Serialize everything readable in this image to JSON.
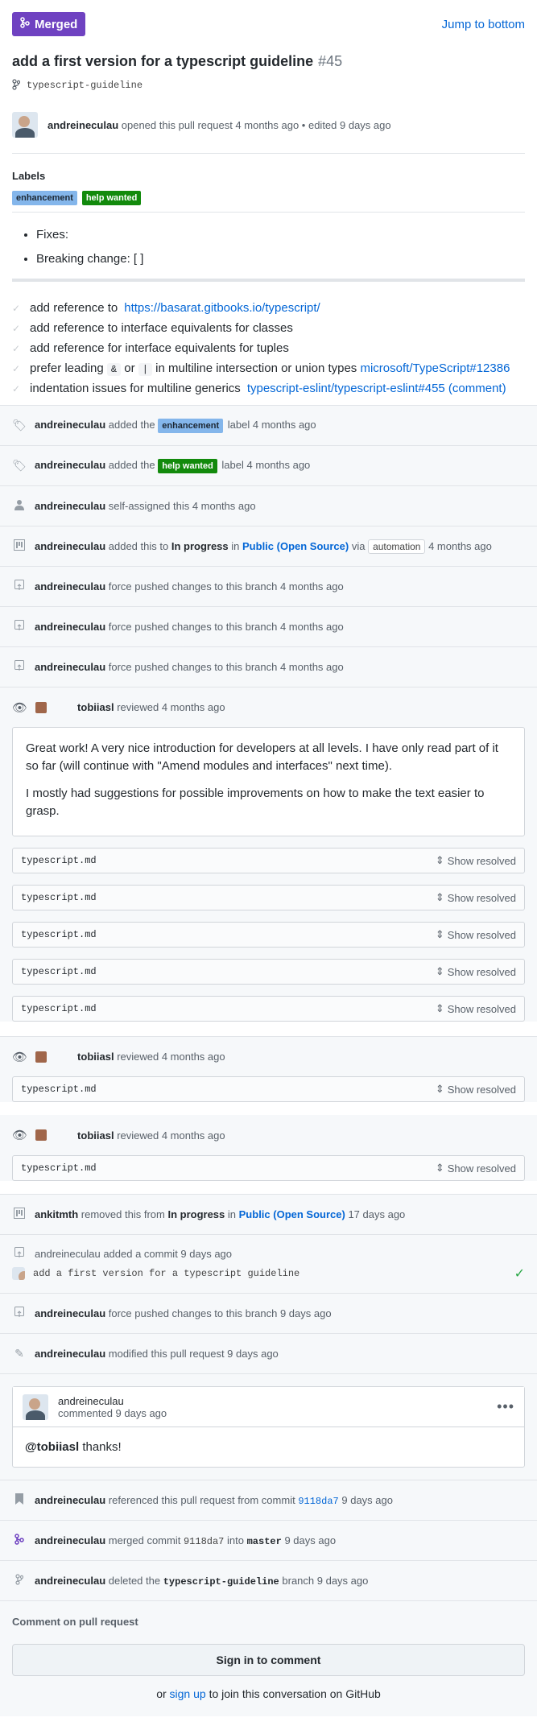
{
  "header": {
    "state": "Merged",
    "jump": "Jump to bottom"
  },
  "pr": {
    "title": "add a first version for a typescript guideline",
    "number": "#45",
    "branch": "typescript-guideline"
  },
  "opened": {
    "author": "andreineculau",
    "text": "opened this pull request 4 months ago • edited 9 days ago"
  },
  "labels": {
    "heading": "Labels",
    "items": [
      "enhancement",
      "help wanted"
    ]
  },
  "body": {
    "items": [
      "Fixes:",
      "Breaking change: [ ]"
    ]
  },
  "tasks": {
    "t1_text": "add reference to",
    "t1_link": "https://basarat.gitbooks.io/typescript/",
    "t2_text": "add reference to interface equivalents for classes",
    "t3_text": "add reference for interface equivalents for tuples",
    "t4_pre": "prefer leading",
    "t4_code1": "&",
    "t4_or": "or",
    "t4_code2": "|",
    "t4_mid": "in multiline intersection or union types",
    "t4_link": "microsoft/TypeScript#12386",
    "t5_text": "indentation issues for multiline generics",
    "t5_link": "typescript-eslint/typescript-eslint#455 (comment)"
  },
  "events": {
    "e1": {
      "author": "andreineculau",
      "a": "added the",
      "label": "enhancement",
      "b": "label 4 months ago"
    },
    "e2": {
      "author": "andreineculau",
      "a": "added the",
      "label": "help wanted",
      "b": "label 4 months ago"
    },
    "e3": {
      "author": "andreineculau",
      "text": "self-assigned this 4 months ago"
    },
    "e4": {
      "author": "andreineculau",
      "a": "added this to",
      "col": "In progress",
      "in": "in",
      "project": "Public (Open Source)",
      "via": "via",
      "pill": "automation",
      "time": "4 months ago"
    },
    "push": {
      "author": "andreineculau",
      "text": "force pushed changes to this branch 4 months ago"
    },
    "r": {
      "author": "tobiiasl",
      "text": "reviewed 4 months ago"
    },
    "review_p1": "Great work! A very nice introduction for developers at all levels. I have only read part of it so far (will continue with \"Amend modules and interfaces\" next time).",
    "review_p2": "I mostly had suggestions for possible improvements on how to make the text easier to grasp.",
    "file": "typescript.md",
    "show_resolved": "Show resolved",
    "e5": {
      "author": "ankitmth",
      "a": "removed this from",
      "col": "In progress",
      "in": "in",
      "project": "Public (Open Source)",
      "time": "17 days ago"
    },
    "e6": {
      "author": "andreineculau",
      "text": "added a commit 9 days ago",
      "commit_msg": "add a first version for a typescript guideline"
    },
    "e7": {
      "author": "andreineculau",
      "text": "force pushed changes to this branch 9 days ago"
    },
    "e8": {
      "author": "andreineculau",
      "text": "modified this pull request 9 days ago"
    },
    "comment": {
      "author": "andreineculau",
      "time": "commented 9 days ago",
      "mention": "@tobiiasl",
      "text": "thanks!"
    },
    "e9": {
      "author": "andreineculau",
      "a": "referenced this pull request from commit",
      "sha": "9118da7",
      "time": "9 days ago"
    },
    "e10": {
      "author": "andreineculau",
      "a": "merged commit",
      "sha": "9118da7",
      "into": "into",
      "branch": "master",
      "time": "9 days ago"
    },
    "e11": {
      "author": "andreineculau",
      "a": "deleted the",
      "branch": "typescript-guideline",
      "b": "branch 9 days ago"
    }
  },
  "footer": {
    "heading": "Comment on pull request",
    "signin": "Sign in to comment",
    "or": "or",
    "signup": "sign up",
    "join": "to join this conversation on GitHub"
  },
  "colors": {
    "merged": "#6f42c1",
    "link": "#0366d6",
    "enhancement": "#84b6eb",
    "help_wanted": "#128a0c"
  }
}
